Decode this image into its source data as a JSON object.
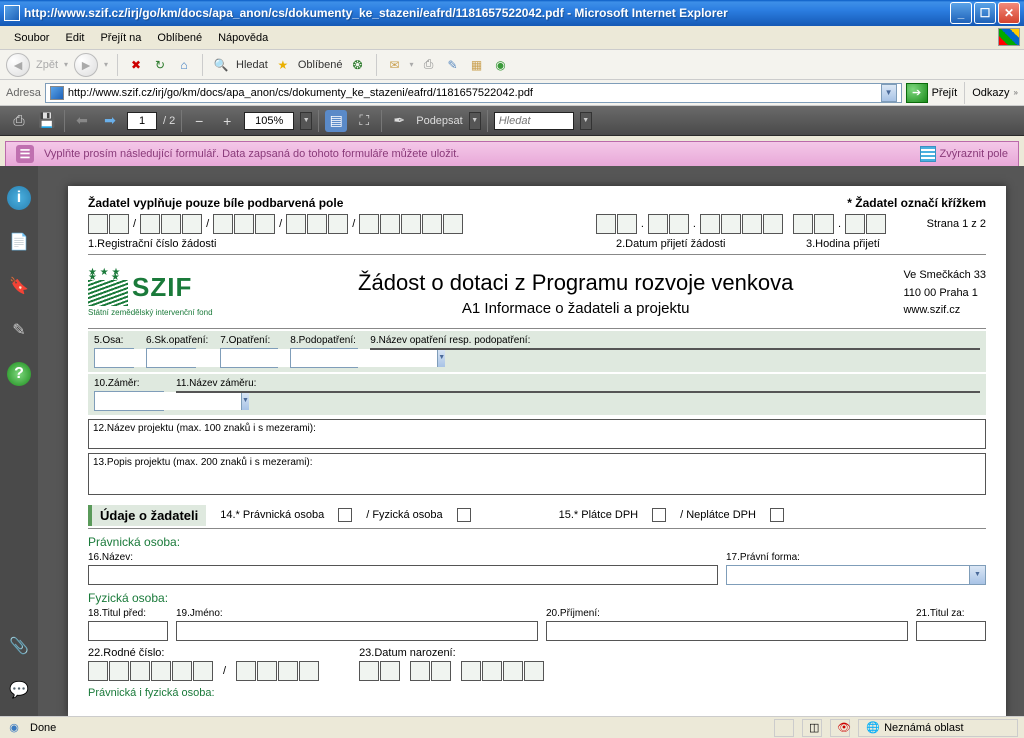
{
  "window": {
    "title": "http://www.szif.cz/irj/go/km/docs/apa_anon/cs/dokumenty_ke_stazeni/eafrd/1181657522042.pdf - Microsoft Internet Explorer"
  },
  "menu": {
    "file": "Soubor",
    "edit": "Edit",
    "goto": "Přejít na",
    "fav": "Oblíbené",
    "help": "Nápověda"
  },
  "ietb": {
    "back": "Zpět",
    "search": "Hledat",
    "favorites": "Oblíbené"
  },
  "address": {
    "label": "Adresa",
    "url": "http://www.szif.cz/irj/go/km/docs/apa_anon/cs/dokumenty_ke_stazeni/eafrd/1181657522042.pdf",
    "go": "Přejít",
    "links": "Odkazy"
  },
  "pdf": {
    "page": "1",
    "pages": "/ 2",
    "zoom": "105%",
    "sign": "Podepsat",
    "search_ph": "Hledat"
  },
  "info": {
    "msg": "Vyplňte prosím následující formulář. Data zapsaná do tohoto formuláře můžete uložit.",
    "highlight": "Zvýraznit pole"
  },
  "form": {
    "instr": "Žadatel vyplňuje pouze bíle podbarvená pole",
    "star": "* Žadatel označí křížkem",
    "page": "Strana 1 z 2",
    "f1": "1.Registrační číslo žádosti",
    "f2": "2.Datum přijetí žádosti",
    "f3": "3.Hodina přijetí",
    "title": "Žádost o dotaci z Programu rozvoje venkova",
    "subtitle": "A1 Informace o žadateli a projektu",
    "addr1": "Ve Smečkách 33",
    "addr2": "110 00 Praha 1",
    "addr3": "www.szif.cz",
    "logo": "SZIF",
    "logosub": "Státní zemědělský intervenční fond",
    "l5": "5.Osa:",
    "l6": "6.Sk.opatření:",
    "l7": "7.Opatření:",
    "l8": "8.Podopatření:",
    "l9": "9.Název opatření resp. podopatření:",
    "l10": "10.Záměr:",
    "l11": "11.Název záměru:",
    "l12": "12.Název projektu (max. 100 znaků i s mezerami):",
    "l13": "13.Popis projektu (max. 200 znaků i s mezerami):",
    "secA": "Údaje o žadateli",
    "l14": "14.* Právnická osoba",
    "l14b": "/  Fyzická osoba",
    "l15": "15.* Plátce DPH",
    "l15b": "/  Neplátce DPH",
    "grpLegal": "Právnická osoba:",
    "l16": "16.Název:",
    "l17": "17.Právní forma:",
    "grpPhys": "Fyzická osoba:",
    "l18": "18.Titul před:",
    "l19": "19.Jméno:",
    "l20": "20.Příjmení:",
    "l21": "21.Titul za:",
    "l22": "22.Rodné číslo:",
    "l23": "23.Datum narození:",
    "grpBoth": "Právnická i fyzická osoba:"
  },
  "status": {
    "done": "Done",
    "zone": "Neznámá oblast"
  }
}
